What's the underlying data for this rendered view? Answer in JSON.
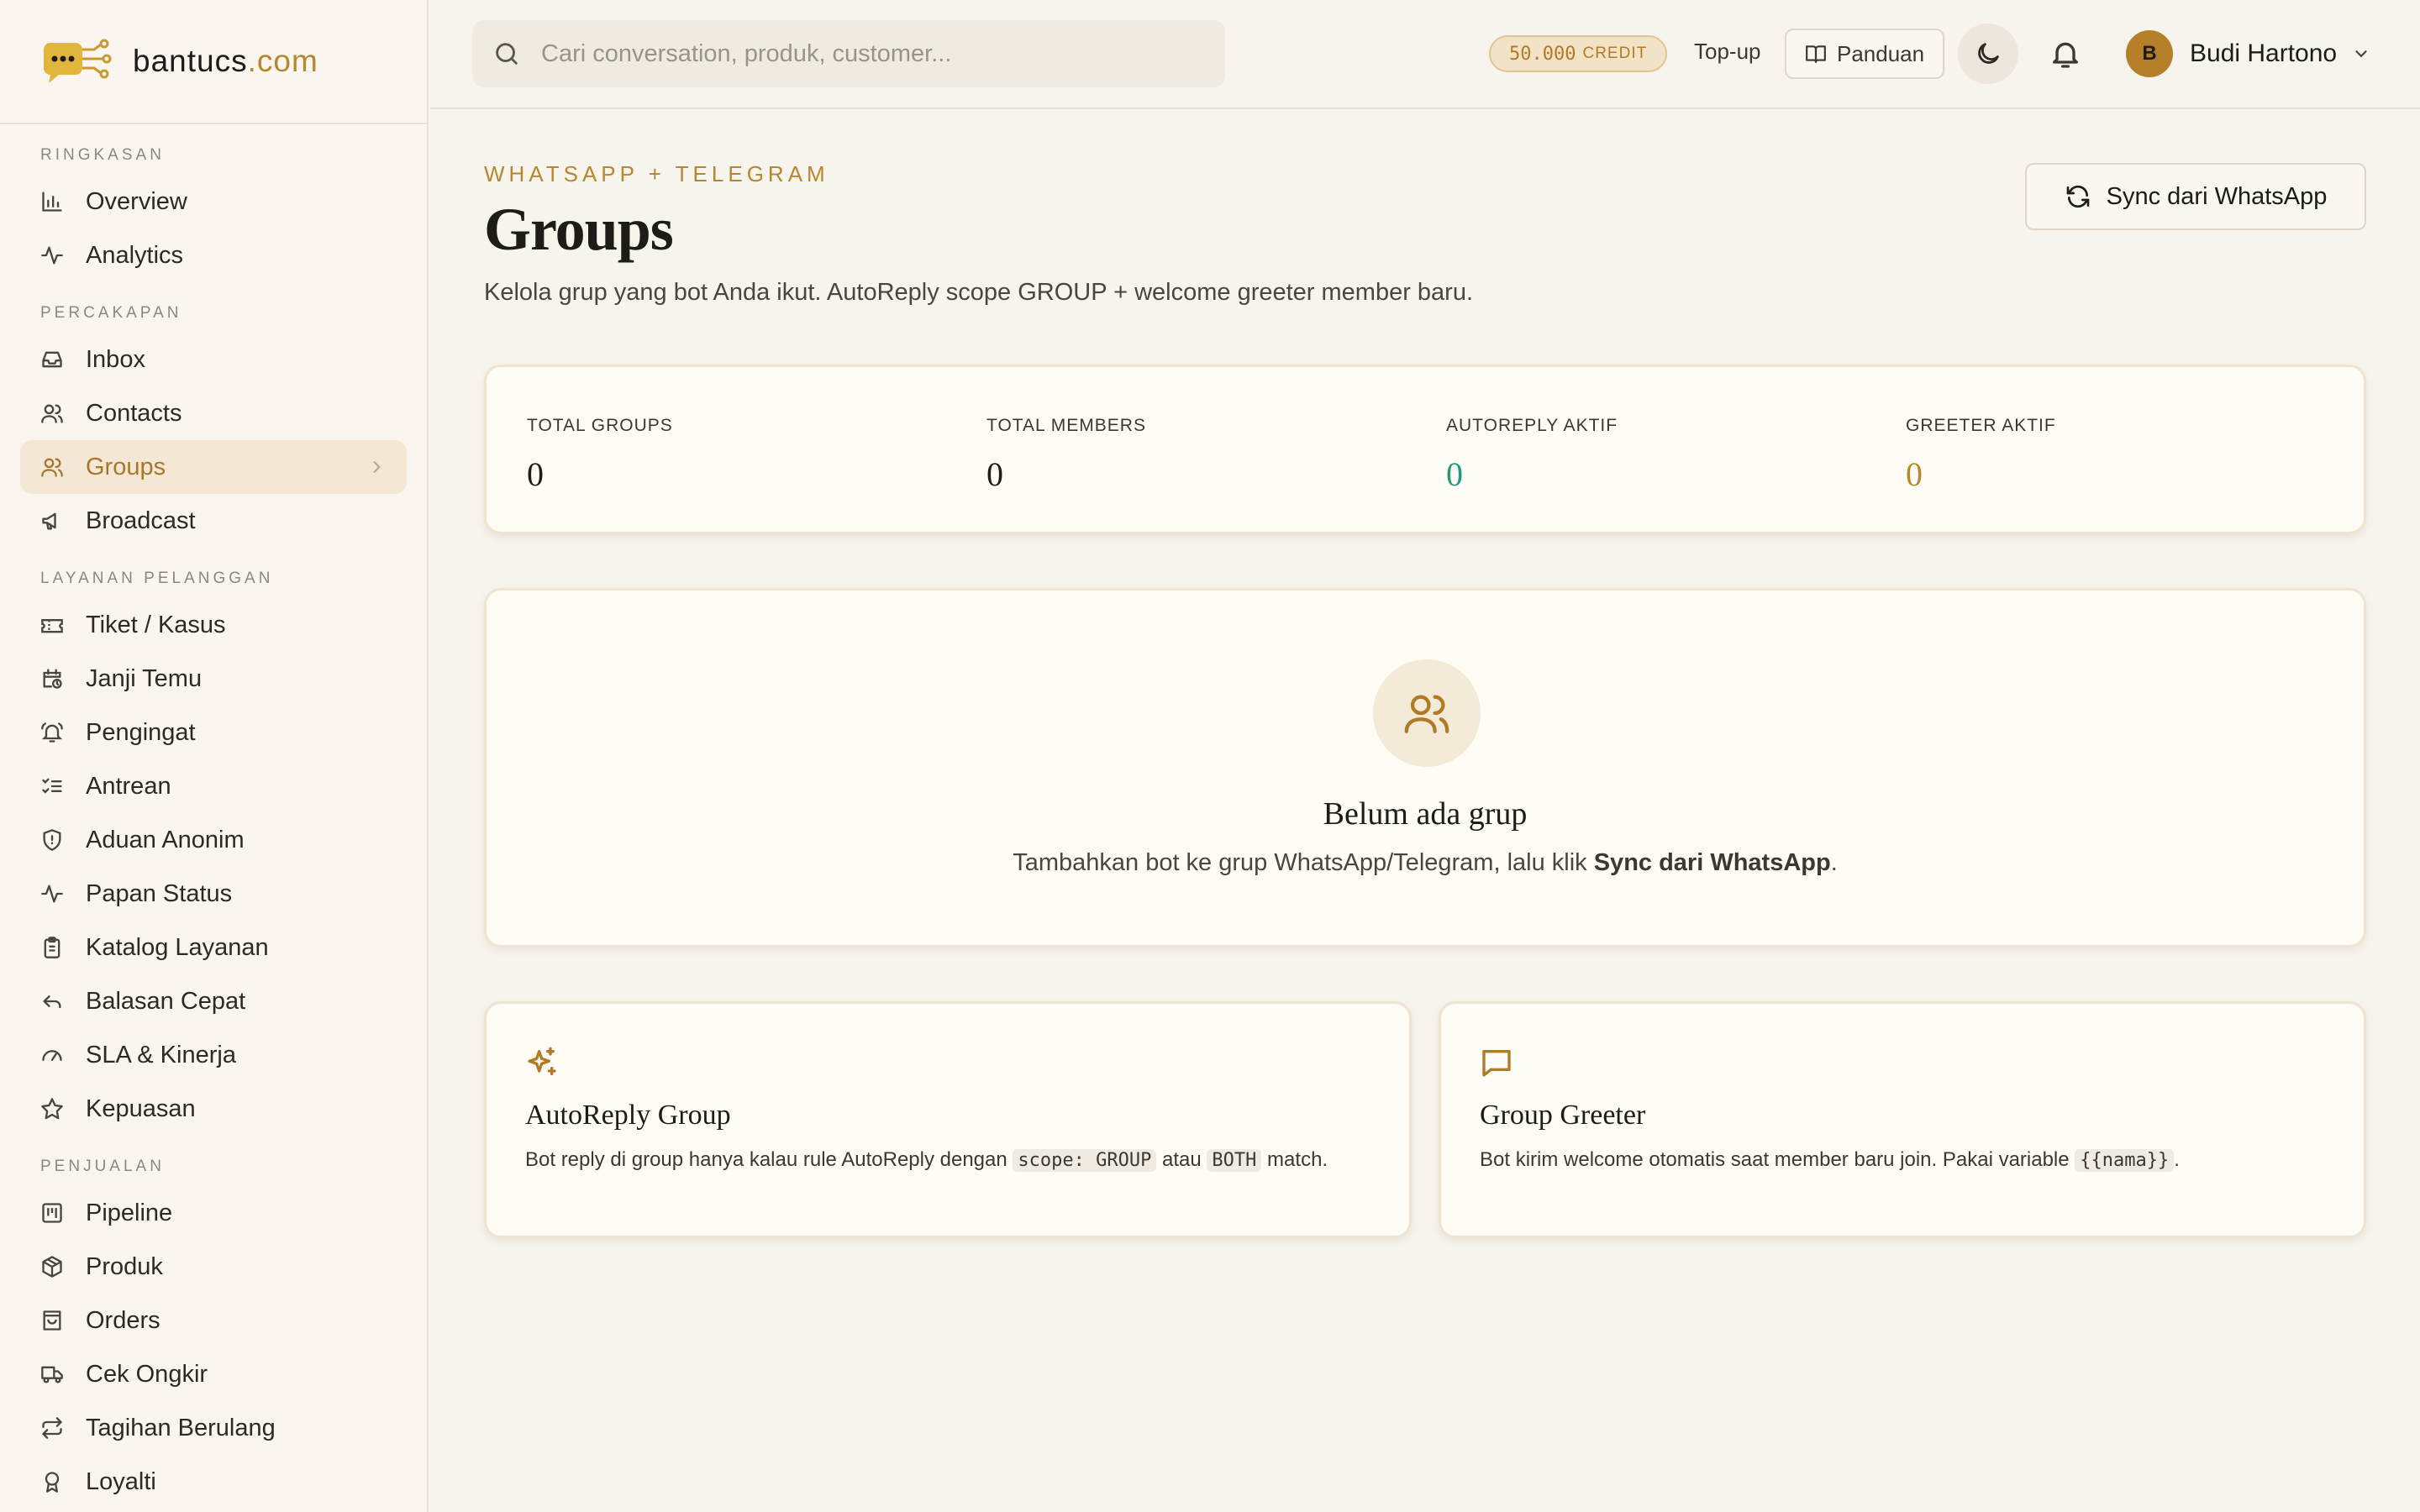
{
  "brand": {
    "name": "bantucs",
    "tld": ".com"
  },
  "sidebar": {
    "sections": [
      {
        "title": "RINGKASAN",
        "items": [
          {
            "label": "Overview",
            "icon": "bar-chart-icon"
          },
          {
            "label": "Analytics",
            "icon": "activity-icon"
          }
        ]
      },
      {
        "title": "PERCAKAPAN",
        "items": [
          {
            "label": "Inbox",
            "icon": "inbox-icon"
          },
          {
            "label": "Contacts",
            "icon": "users-icon"
          },
          {
            "label": "Groups",
            "icon": "users-icon",
            "active": true
          },
          {
            "label": "Broadcast",
            "icon": "megaphone-icon"
          }
        ]
      },
      {
        "title": "LAYANAN PELANGGAN",
        "items": [
          {
            "label": "Tiket / Kasus",
            "icon": "ticket-icon"
          },
          {
            "label": "Janji Temu",
            "icon": "calendar-clock-icon"
          },
          {
            "label": "Pengingat",
            "icon": "bell-ring-icon"
          },
          {
            "label": "Antrean",
            "icon": "list-checks-icon"
          },
          {
            "label": "Aduan Anonim",
            "icon": "shield-icon"
          },
          {
            "label": "Papan Status",
            "icon": "pulse-icon"
          },
          {
            "label": "Katalog Layanan",
            "icon": "clipboard-icon"
          },
          {
            "label": "Balasan Cepat",
            "icon": "reply-icon"
          },
          {
            "label": "SLA & Kinerja",
            "icon": "gauge-icon"
          },
          {
            "label": "Kepuasan",
            "icon": "star-icon"
          }
        ]
      },
      {
        "title": "PENJUALAN",
        "items": [
          {
            "label": "Pipeline",
            "icon": "kanban-icon"
          },
          {
            "label": "Produk",
            "icon": "package-icon"
          },
          {
            "label": "Orders",
            "icon": "shopping-bag-icon"
          },
          {
            "label": "Cek Ongkir",
            "icon": "truck-icon"
          },
          {
            "label": "Tagihan Berulang",
            "icon": "repeat-icon"
          },
          {
            "label": "Loyalti",
            "icon": "award-icon"
          }
        ]
      }
    ]
  },
  "topbar": {
    "search_placeholder": "Cari conversation, produk, customer...",
    "credit_amount": "50.000",
    "credit_label": "CREDIT",
    "topup_label": "Top-up",
    "panduan_label": "Panduan",
    "user_initial": "B",
    "user_name": "Budi Hartono"
  },
  "page": {
    "kicker": "WHATSAPP + TELEGRAM",
    "title": "Groups",
    "subtitle": "Kelola grup yang bot Anda ikut. AutoReply scope GROUP + welcome greeter member baru.",
    "sync_label": "Sync dari WhatsApp"
  },
  "stats": [
    {
      "label": "TOTAL GROUPS",
      "value": "0"
    },
    {
      "label": "TOTAL MEMBERS",
      "value": "0"
    },
    {
      "label": "AUTOREPLY AKTIF",
      "value": "0"
    },
    {
      "label": "GREETER AKTIF",
      "value": "0"
    }
  ],
  "empty": {
    "title": "Belum ada grup",
    "desc_prefix": "Tambahkan bot ke grup WhatsApp/Telegram, lalu klik ",
    "desc_bold": "Sync dari WhatsApp",
    "desc_suffix": "."
  },
  "features": {
    "autoreply": {
      "title": "AutoReply Group",
      "desc_1": "Bot reply di group hanya kalau rule AutoReply dengan ",
      "code_1": "scope: GROUP",
      "desc_2": " atau ",
      "code_2": "BOTH",
      "desc_3": " match."
    },
    "greeter": {
      "title": "Group Greeter",
      "desc_1": "Bot kirim welcome otomatis saat member baru join. Pakai variable ",
      "code_1": "{{nama}}",
      "desc_2": "."
    }
  },
  "colors": {
    "accent": "#b8862e",
    "active_bg": "#f4e7d6",
    "teal": "#1f9a7b",
    "background": "#f7f4ee"
  }
}
